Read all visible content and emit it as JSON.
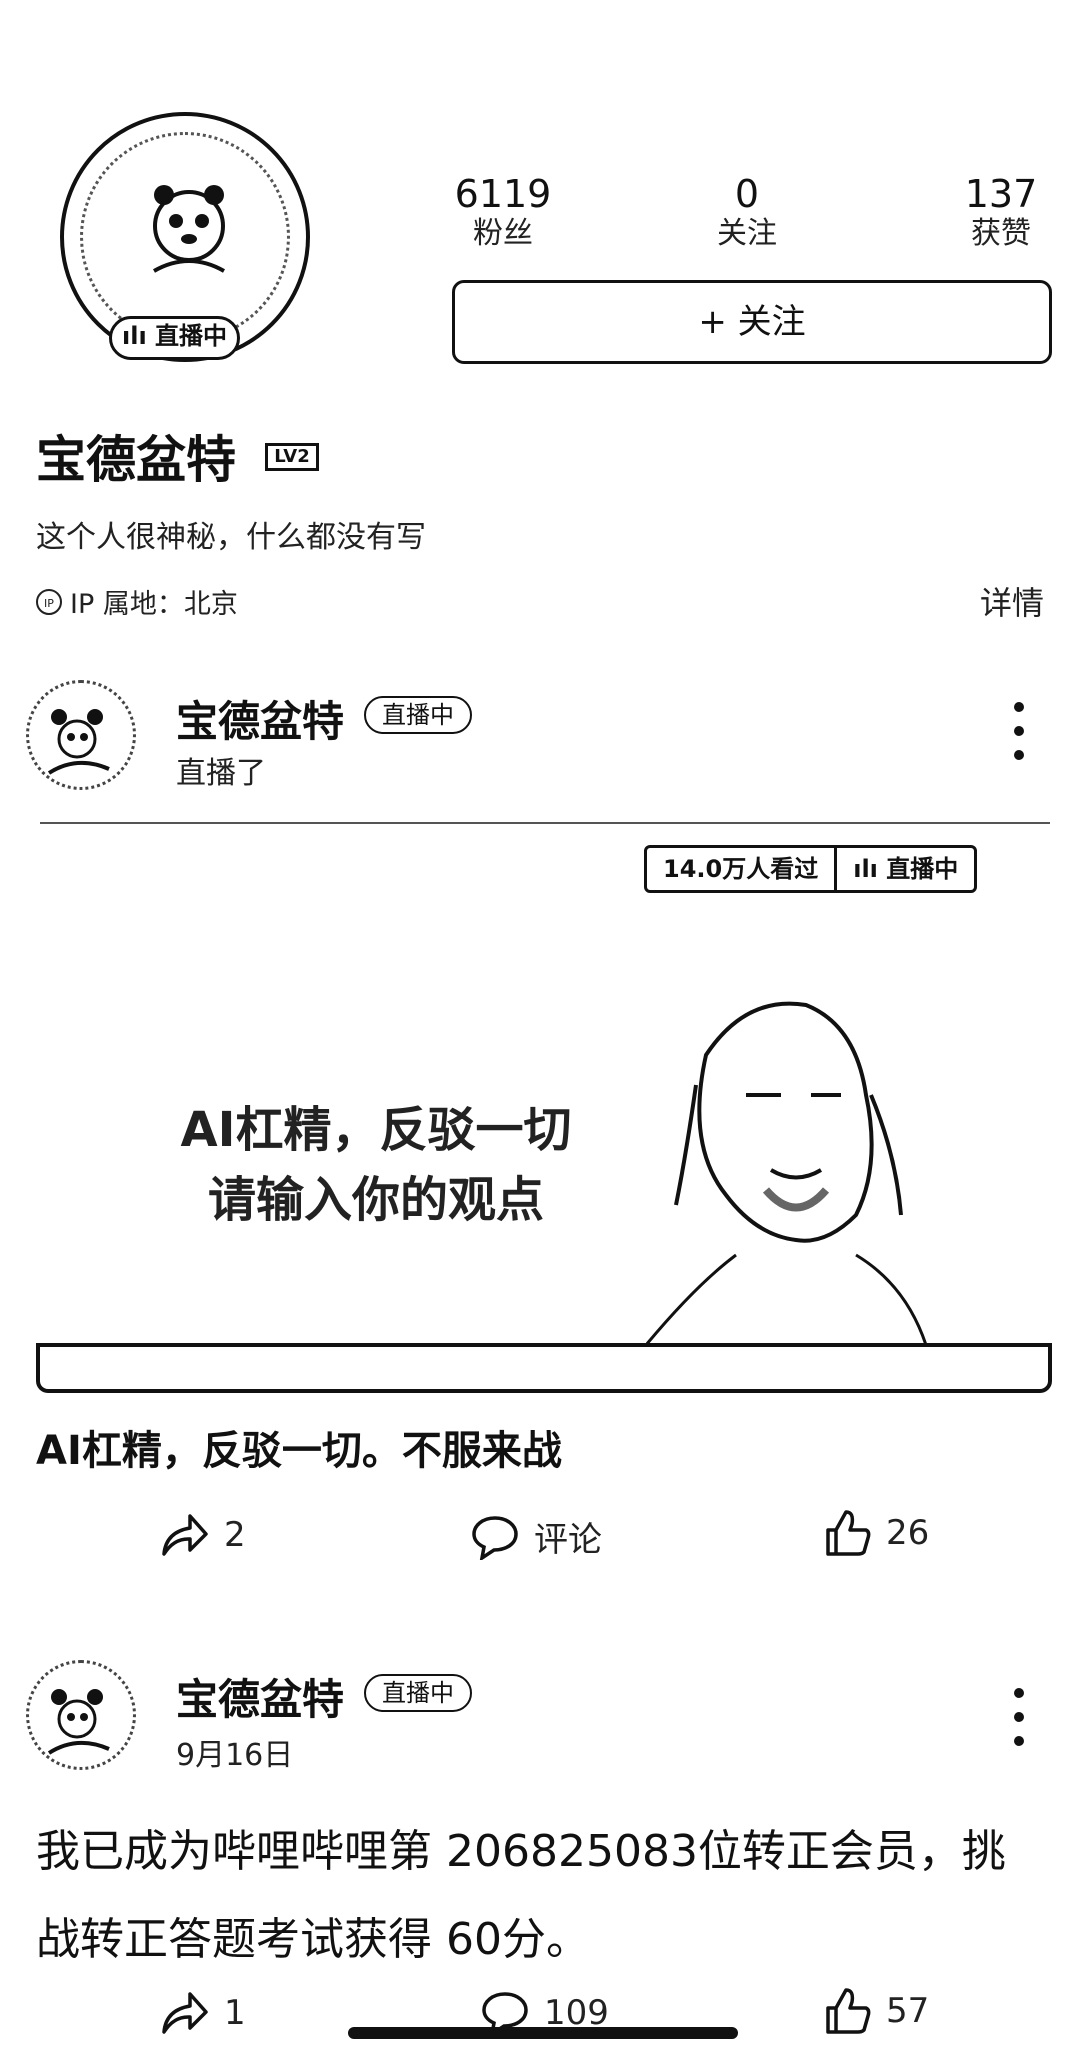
{
  "profile": {
    "live_badge": "直播中",
    "stats": [
      {
        "value": "6119",
        "label": "粉丝"
      },
      {
        "value": "0",
        "label": "关注"
      },
      {
        "value": "137",
        "label": "获赞"
      }
    ],
    "follow_label": "+ 关注",
    "name": "宝德盆特",
    "level_badge": "LV2",
    "bio": "这个人很神秘，什么都没有写",
    "ip_icon": "IP",
    "ip_location": "IP 属地：北京",
    "detail_link": "详情"
  },
  "posts": [
    {
      "author": "宝德盆特",
      "live_tag": "直播中",
      "subtitle": "直播了",
      "views": "14.0万人看过",
      "live_status": "直播中",
      "video_line1": "AI杠精，反驳一切",
      "video_line2": "请输入你的观点",
      "title": "AI杠精，反驳一切。不服来战",
      "share_count": "2",
      "comment_label": "评论",
      "like_count": "26"
    },
    {
      "author": "宝德盆特",
      "live_tag": "直播中",
      "subtitle": "9月16日",
      "text": "我已成为哔哩哔哩第 206825083位转正会员，挑战转正答题考试获得 60分。",
      "share_count": "1",
      "comment_count": "109",
      "like_count": "57"
    }
  ],
  "icons": [
    "share-icon",
    "comment-icon",
    "like-icon",
    "more-icon",
    "live-wave-icon"
  ]
}
